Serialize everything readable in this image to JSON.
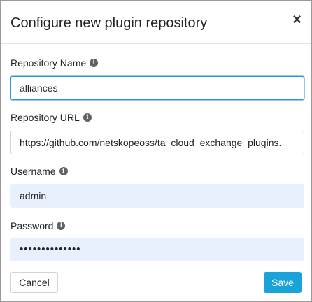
{
  "modal": {
    "title": "Configure new plugin repository",
    "close_glyph": "×"
  },
  "fields": {
    "name": {
      "label": "Repository Name",
      "value": "alliances"
    },
    "url": {
      "label": "Repository URL",
      "value": "https://github.com/netskopeoss/ta_cloud_exchange_plugins."
    },
    "username": {
      "label": "Username",
      "value": "admin"
    },
    "password": {
      "label": "Password",
      "value": "••••••••••••••"
    }
  },
  "info_glyph": "i",
  "buttons": {
    "cancel": "Cancel",
    "save": "Save"
  },
  "colors": {
    "accent": "#19a3d9",
    "autofill": "#e8f0fe",
    "focus_border": "#2b9bd6"
  },
  "icons": {
    "close": "close-icon",
    "info": "info-icon"
  }
}
